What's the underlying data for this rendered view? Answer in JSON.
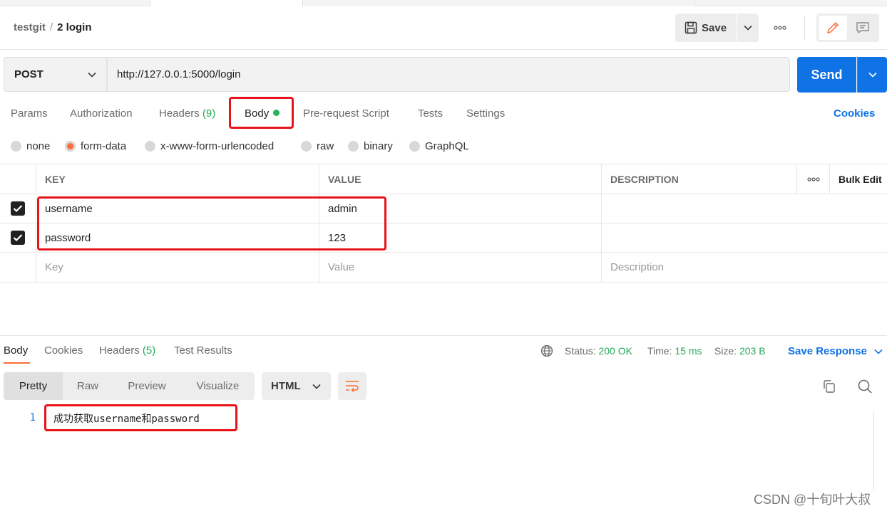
{
  "header": {
    "breadcrumb_parent": "testgit",
    "breadcrumb_sep": "/",
    "breadcrumb_current": "2 login",
    "save_label": "Save"
  },
  "request": {
    "method": "POST",
    "url": "http://127.0.0.1:5000/login",
    "send_label": "Send"
  },
  "request_tabs": {
    "params": "Params",
    "authorization": "Authorization",
    "headers": "Headers",
    "headers_count": "(9)",
    "body": "Body",
    "pre_request": "Pre-request Script",
    "tests": "Tests",
    "settings": "Settings",
    "cookies": "Cookies"
  },
  "body_types": {
    "none": "none",
    "form_data": "form-data",
    "urlencoded": "x-www-form-urlencoded",
    "raw": "raw",
    "binary": "binary",
    "graphql": "GraphQL",
    "selected": "form-data"
  },
  "table": {
    "col_key": "KEY",
    "col_value": "VALUE",
    "col_description": "DESCRIPTION",
    "bulk_edit": "Bulk Edit",
    "rows": [
      {
        "key": "username",
        "value": "admin",
        "description": "",
        "checked": true
      },
      {
        "key": "password",
        "value": "123",
        "description": "",
        "checked": true
      }
    ],
    "placeholder_key": "Key",
    "placeholder_value": "Value",
    "placeholder_description": "Description"
  },
  "response": {
    "tabs": {
      "body": "Body",
      "cookies": "Cookies",
      "headers": "Headers",
      "headers_count": "(5)",
      "test_results": "Test Results"
    },
    "status_label": "Status:",
    "status_value": "200 OK",
    "time_label": "Time:",
    "time_value": "15 ms",
    "size_label": "Size:",
    "size_value": "203 B",
    "save_response": "Save Response",
    "views": {
      "pretty": "Pretty",
      "raw": "Raw",
      "preview": "Preview",
      "visualize": "Visualize"
    },
    "language": "HTML",
    "line_number": "1",
    "body_text": "成功获取username和password"
  },
  "watermark": "CSDN @十旬叶大叔",
  "colors": {
    "accent_blue": "#0f72e5",
    "accent_orange": "#ff6c37",
    "success_green": "#26a85a",
    "annotation_red": "#e8141a"
  }
}
